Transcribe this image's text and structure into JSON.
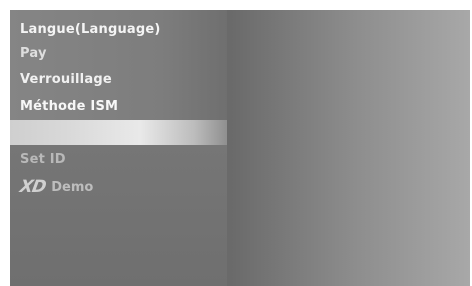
{
  "menu": {
    "items": [
      {
        "label": "Langue(Language)"
      },
      {
        "label": "Pay"
      },
      {
        "label": "Verrouillage"
      },
      {
        "label": "Méthode ISM"
      },
      {
        "label": ""
      },
      {
        "label": "Set ID"
      }
    ],
    "xd_demo": {
      "logo": "XD",
      "label": "Demo"
    }
  }
}
